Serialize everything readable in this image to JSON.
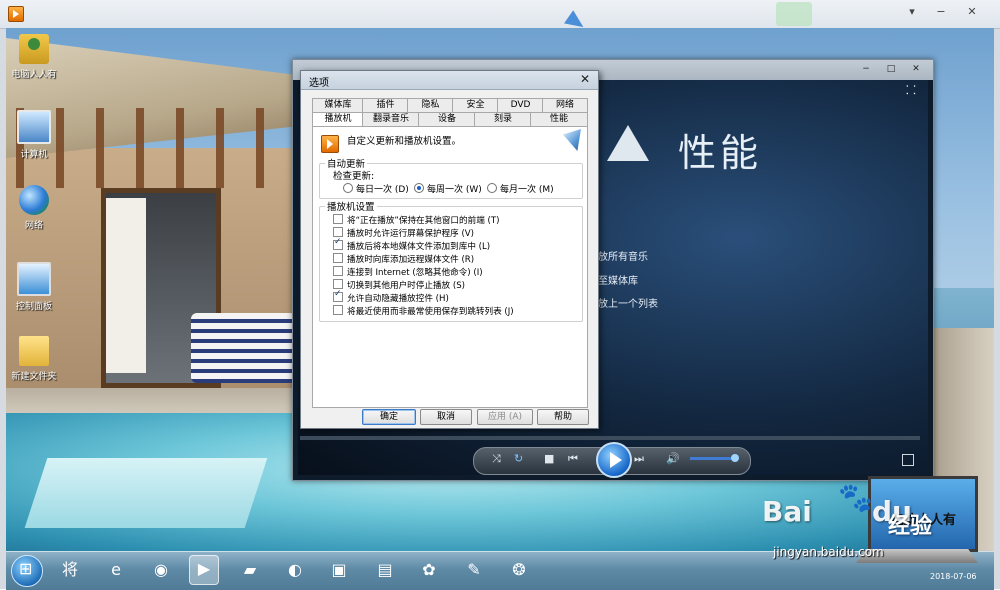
{
  "outer_window": {
    "minimize": "▾",
    "restore": "−",
    "close": "✕"
  },
  "desktop_icons": [
    {
      "label": "电脑人人有",
      "icon": "user-folder-icon"
    },
    {
      "label": "计算机",
      "icon": "computer-icon"
    },
    {
      "label": "网络",
      "icon": "network-icon"
    },
    {
      "label": "控制面板",
      "icon": "control-panel-icon"
    },
    {
      "label": "新建文件夹",
      "icon": "folder-icon"
    }
  ],
  "wmp": {
    "title_heading": "性能",
    "menu_items": [
      "放所有音乐",
      "至媒体库",
      "放上一个列表"
    ],
    "window_controls": {
      "minimize": "−",
      "maximize": "□",
      "close": "✕"
    },
    "playback_icons": {
      "shuffle": "⤨",
      "repeat": "↻",
      "stop": "■",
      "prev": "⏮",
      "next": "⏭",
      "volume": "🔊"
    }
  },
  "dialog": {
    "title": "选项",
    "close": "✕",
    "tabs_row1": [
      "媒体库",
      "插件",
      "隐私",
      "安全",
      "DVD",
      "网络"
    ],
    "tabs_row2": [
      "播放机",
      "翻录音乐",
      "设备",
      "刻录",
      "性能"
    ],
    "active_tab": "播放机",
    "header_text": "自定义更新和播放机设置。",
    "auto_update": {
      "group_label": "自动更新",
      "check_label": "检查更新:",
      "options": [
        {
          "label": "每日一次 (D)",
          "selected": false
        },
        {
          "label": "每周一次 (W)",
          "selected": true
        },
        {
          "label": "每月一次 (M)",
          "selected": false
        }
      ]
    },
    "player_settings": {
      "group_label": "播放机设置",
      "options": [
        {
          "label": "将“正在播放”保持在其他窗口的前端 (T)",
          "checked": false
        },
        {
          "label": "播放时允许运行屏幕保护程序 (V)",
          "checked": false
        },
        {
          "label": "播放后将本地媒体文件添加到库中 (L)",
          "checked": true
        },
        {
          "label": "播放时向库添加远程媒体文件 (R)",
          "checked": false
        },
        {
          "label": "连接到 Internet (忽略其他命令) (I)",
          "checked": false
        },
        {
          "label": "切换到其他用户时停止播放 (S)",
          "checked": false
        },
        {
          "label": "允许自动隐藏播放控件 (H)",
          "checked": true
        },
        {
          "label": "将最近使用而非最常使用保存到跳转列表 (J)",
          "checked": false
        }
      ]
    },
    "buttons": {
      "ok": "确定",
      "cancel": "取消",
      "apply": "应用 (A)",
      "help": "帮助"
    }
  },
  "taskbar": {
    "items": [
      {
        "name": "qihoo-icon",
        "glyph": "将",
        "active": false
      },
      {
        "name": "ie-icon",
        "glyph": "e",
        "active": false
      },
      {
        "name": "chrome-icon",
        "glyph": "◉",
        "active": false
      },
      {
        "name": "wmp-icon",
        "glyph": "▶",
        "active": true
      },
      {
        "name": "notes-icon",
        "glyph": "▰",
        "active": false
      },
      {
        "name": "browser-icon",
        "glyph": "◐",
        "active": false
      },
      {
        "name": "remote-icon",
        "glyph": "▣",
        "active": false
      },
      {
        "name": "explorer-icon",
        "glyph": "▤",
        "active": false
      },
      {
        "name": "tool-icon",
        "glyph": "✿",
        "active": false
      },
      {
        "name": "paint-icon",
        "glyph": "✎",
        "active": false
      },
      {
        "name": "app-icon",
        "glyph": "❂",
        "active": false
      }
    ],
    "date": "2018-07-06"
  },
  "watermark": {
    "baidu": "Bai",
    "paw": "du",
    "jingyan": "经验",
    "url": "jingyan.baidu.com",
    "laptop_text": "电脑人人有"
  },
  "colors": {
    "wmp_bg": "#0d1b2a",
    "dialog_bg": "#f0f0f0",
    "accent_blue": "#1667c9",
    "taskbar": "#5e8aa6"
  }
}
